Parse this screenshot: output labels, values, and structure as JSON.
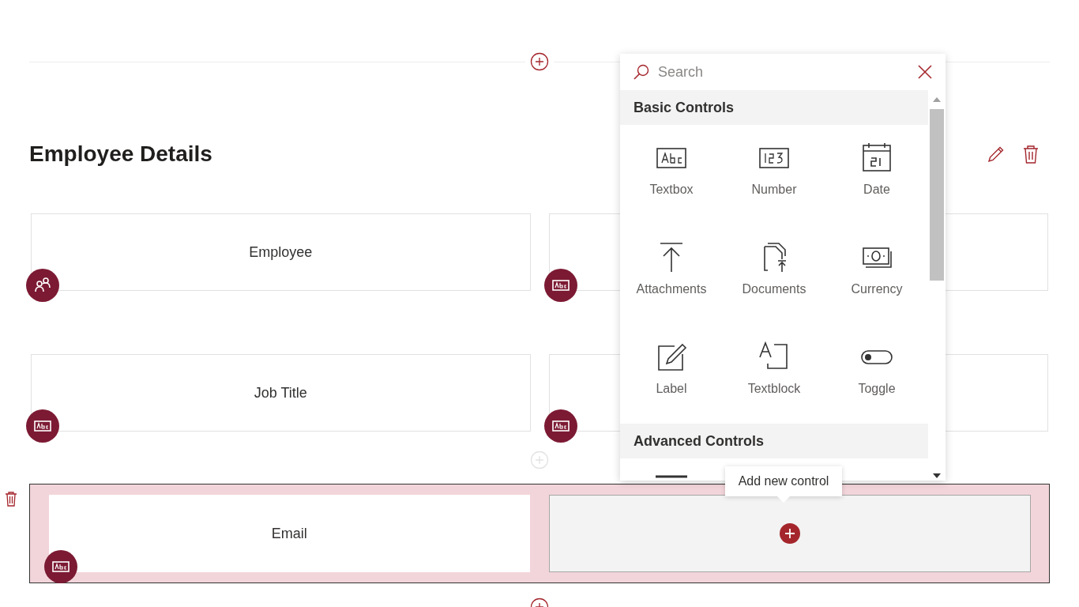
{
  "section": {
    "title": "Employee Details"
  },
  "rows": [
    {
      "selected": false,
      "cards": [
        {
          "label": "Employee",
          "kind": "people"
        },
        {
          "kind": "text"
        }
      ]
    },
    {
      "selected": false,
      "cards": [
        {
          "label": "Job Title",
          "kind": "text"
        },
        {
          "kind": "text"
        }
      ]
    },
    {
      "selected": true,
      "cards": [
        {
          "label": "Email",
          "kind": "text"
        },
        {
          "kind": "empty"
        }
      ]
    }
  ],
  "tooltip": {
    "text": "Add new control"
  },
  "picker": {
    "search": {
      "placeholder": "Search"
    },
    "groups": [
      {
        "title": "Basic Controls",
        "items": [
          {
            "label": "Textbox",
            "kind": "textbox"
          },
          {
            "label": "Number",
            "kind": "number"
          },
          {
            "label": "Date",
            "kind": "date"
          },
          {
            "label": "Attachments",
            "kind": "attach"
          },
          {
            "label": "Documents",
            "kind": "docs"
          },
          {
            "label": "Currency",
            "kind": "currency"
          },
          {
            "label": "Label",
            "kind": "label"
          },
          {
            "label": "Textblock",
            "kind": "textblock"
          },
          {
            "label": "Toggle",
            "kind": "toggle"
          }
        ]
      },
      {
        "title": "Advanced Controls",
        "items": [
          {
            "kind": "line"
          }
        ]
      }
    ]
  }
}
